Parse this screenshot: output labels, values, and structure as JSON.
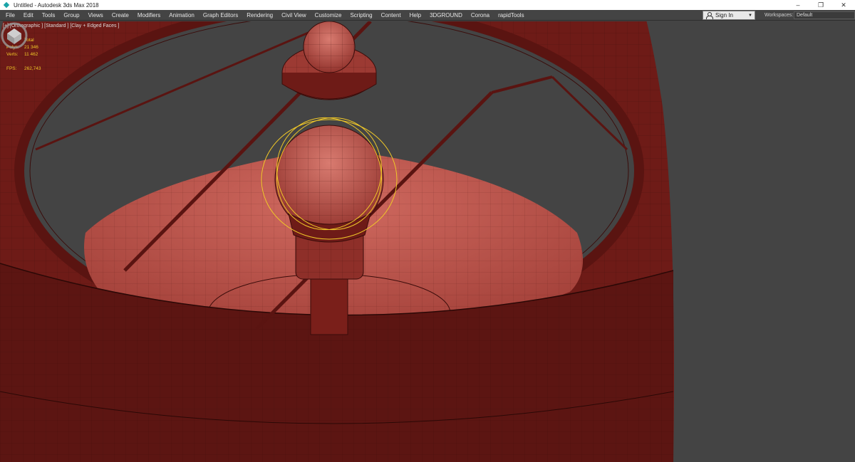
{
  "window": {
    "title": "Untitled - Autodesk 3ds Max 2018",
    "controls": {
      "minimize": "–",
      "restore": "❐",
      "close": "✕"
    }
  },
  "menu": {
    "items": [
      "File",
      "Edit",
      "Tools",
      "Group",
      "Views",
      "Create",
      "Modifiers",
      "Animation",
      "Graph Editors",
      "Rendering",
      "Civil View",
      "Customize",
      "Scripting",
      "Content",
      "Help",
      "3DGROUND",
      "Corona",
      "rapidTools"
    ],
    "sign_in": "Sign In",
    "workspaces_label": "Workspaces:",
    "workspaces_value": "Default"
  },
  "viewport": {
    "label": "[+] [Orthographic ] [Standard ] [Clay + Edged Faces ]",
    "stats": {
      "header": "Total",
      "polys_label": "Polys:",
      "polys_value": "21 346",
      "verts_label": "Verts:",
      "verts_value": "11 462",
      "fps_label": "FPS:",
      "fps_value": "262,743"
    }
  },
  "colors": {
    "ui_bg": "#444444",
    "clay": "#b0463e",
    "clay_dark": "#4a0f0d",
    "edges": "#3a0c0a",
    "selection": "#f0c828",
    "stats_text": "#f0c828"
  },
  "icons": [
    "app-icon",
    "user-icon",
    "chevron-down-icon",
    "viewcube-icon"
  ]
}
